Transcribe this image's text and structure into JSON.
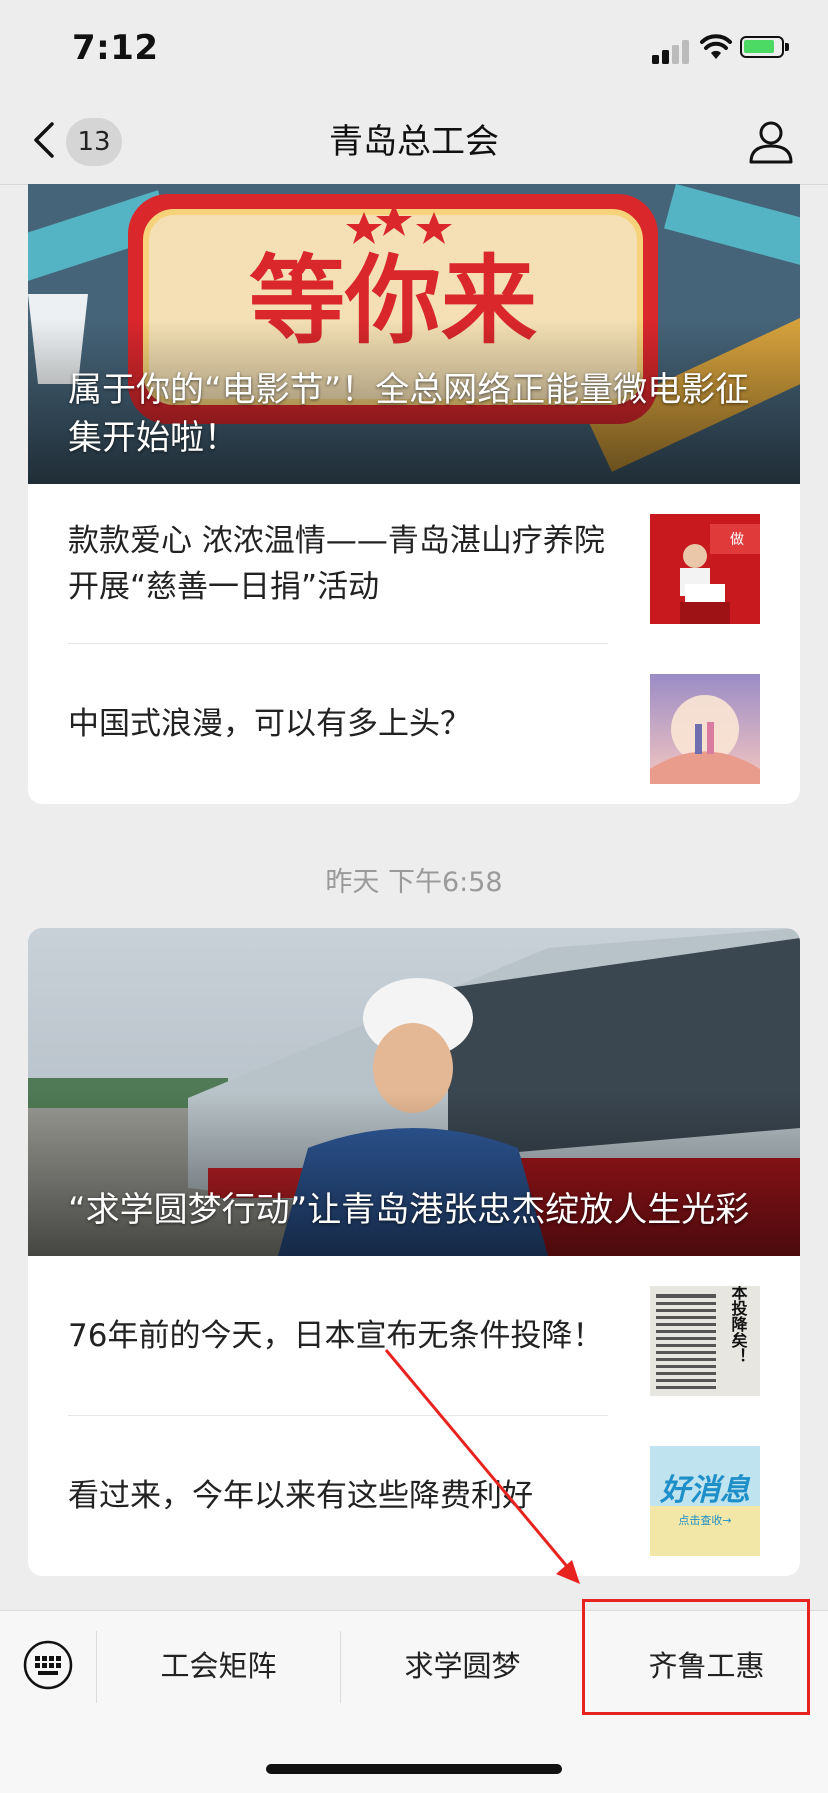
{
  "status_bar": {
    "time": "7:12"
  },
  "nav": {
    "back_count": "13",
    "title": "青岛总工会"
  },
  "article_group_1": {
    "hero_banner_text": "等你来",
    "hero_title": "属于你的“电影节”！全总网络正能量微电影征集开始啦！",
    "items": [
      {
        "title": "款款爱心 浓浓温情——青岛湛山疗养院开展“慈善一日捐”活动"
      },
      {
        "title": "中国式浪漫，可以有多上头？"
      }
    ]
  },
  "timestamp": "昨天 下午6:58",
  "article_group_2": {
    "hero_title": "“求学圆梦行动”让青岛港张忠杰绽放人生光彩",
    "items": [
      {
        "title": "76年前的今天，日本宣布无条件投降！",
        "thumb_text": "日本投降矣！"
      },
      {
        "title": "看过来，今年以来有这些降费利好",
        "thumb_text": "好消息",
        "thumb_sub": "点击查收→"
      }
    ]
  },
  "bottom_menu": {
    "items": [
      {
        "label": "工会矩阵"
      },
      {
        "label": "求学圆梦"
      },
      {
        "label": "齐鲁工惠"
      }
    ]
  },
  "colors": {
    "highlight": "#e8231f",
    "background": "#ededed",
    "battery": "#4cd964"
  },
  "icons": [
    "back-chevron-icon",
    "user-profile-icon",
    "keyboard-icon",
    "signal-icon",
    "wifi-icon",
    "battery-icon"
  ]
}
